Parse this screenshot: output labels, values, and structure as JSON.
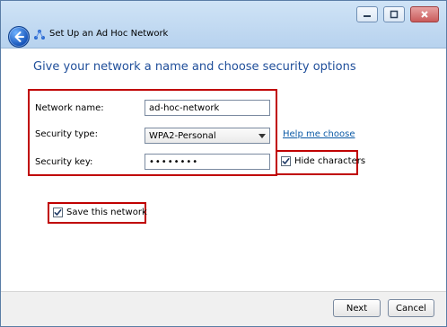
{
  "window": {
    "title": "Set Up an Ad Hoc Network"
  },
  "page": {
    "heading": "Give your network a name and choose security options"
  },
  "form": {
    "network_name_label": "Network name:",
    "network_name_value": "ad-hoc-network",
    "security_type_label": "Security type:",
    "security_type_value": "WPA2-Personal",
    "security_key_label": "Security key:",
    "security_key_value": "••••••••",
    "help_link": "Help me choose",
    "hide_characters_label": "Hide characters",
    "save_network_label": "Save this network"
  },
  "footer": {
    "next_label": "Next",
    "cancel_label": "Cancel"
  },
  "colors": {
    "highlight": "#c00000",
    "heading": "#1f4e9a",
    "link": "#0b5aa6"
  },
  "icons": {
    "back": "back-arrow-icon",
    "network": "network-icon",
    "minimize": "minimize-icon",
    "maximize": "maximize-icon",
    "close": "close-icon",
    "checkmark": "checkmark-icon",
    "dropdown": "chevron-down-icon"
  }
}
